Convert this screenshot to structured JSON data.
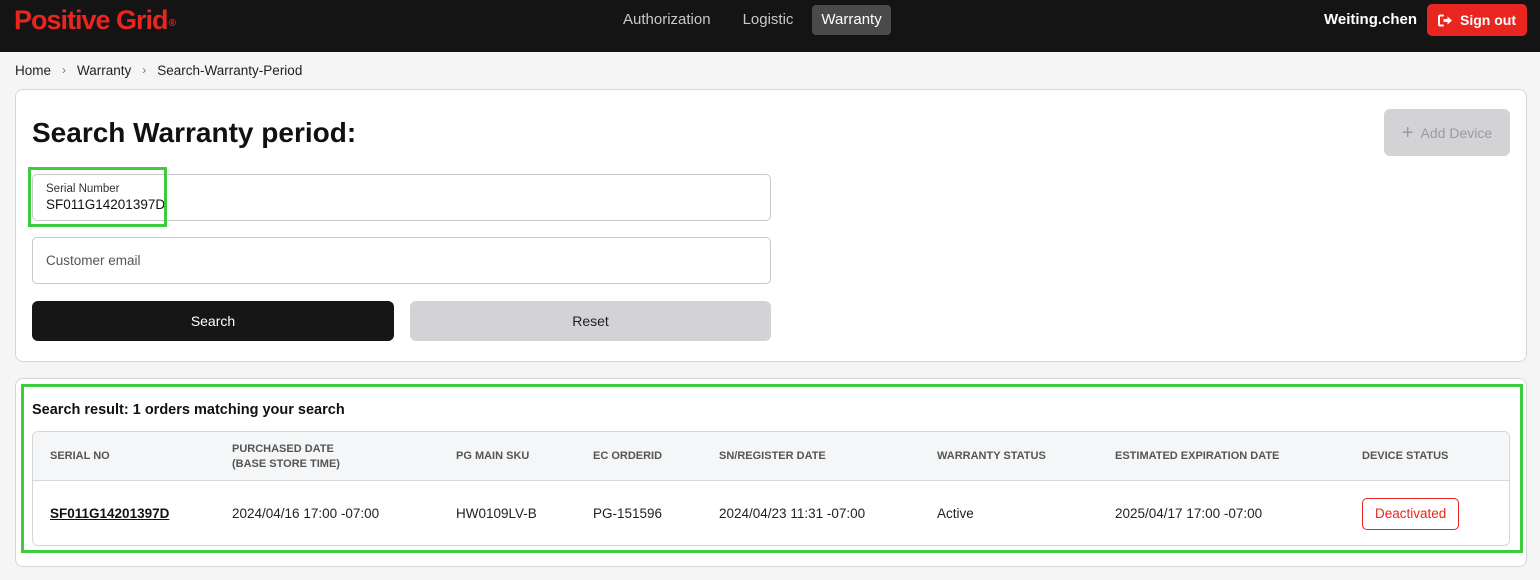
{
  "header": {
    "logo_text": "Positive Grid",
    "logo_mark": "®",
    "nav": [
      {
        "label": "Authorization",
        "active": false
      },
      {
        "label": "Logistic",
        "active": false
      },
      {
        "label": "Warranty",
        "active": true
      }
    ],
    "username": "Weiting.chen",
    "signout_label": "Sign out",
    "signout_icon": "sign-out-icon"
  },
  "breadcrumb": [
    "Home",
    "Warranty",
    "Search-Warranty-Period"
  ],
  "search_form": {
    "title": "Search Warranty period:",
    "add_device_label": "Add Device",
    "serial_label": "Serial Number",
    "serial_value": "SF011G14201397D",
    "email_placeholder": "Customer email",
    "search_button": "Search",
    "reset_button": "Reset"
  },
  "results": {
    "summary": "Search result: 1 orders matching your search",
    "columns": [
      "SERIAL NO",
      "PURCHASED DATE\n(BASE STORE TIME)",
      "PG MAIN SKU",
      "EC ORDERID",
      "SN/REGISTER DATE",
      "WARRANTY STATUS",
      "ESTIMATED EXPIRATION DATE",
      "DEVICE STATUS"
    ],
    "columns_display": {
      "serial_no": "SERIAL NO",
      "purchased_line1": "PURCHASED DATE",
      "purchased_line2": "(BASE STORE TIME)",
      "sku": "PG MAIN SKU",
      "order": "EC ORDERID",
      "register": "SN/REGISTER DATE",
      "warranty": "WARRANTY STATUS",
      "expiration": "ESTIMATED EXPIRATION DATE",
      "device": "DEVICE STATUS"
    },
    "rows": [
      {
        "serial_no": "SF011G14201397D",
        "purchased_date": "2024/04/16 17:00 -07:00",
        "sku": "HW0109LV-B",
        "order_id": "PG-151596",
        "register_date": "2024/04/23 11:31 -07:00",
        "warranty_status": "Active",
        "expiration_date": "2025/04/17 17:00 -07:00",
        "device_status": "Deactivated"
      }
    ]
  },
  "colors": {
    "brand_red": "#e8251f",
    "topbar": "#141414",
    "highlight": "#3ccc3c"
  }
}
